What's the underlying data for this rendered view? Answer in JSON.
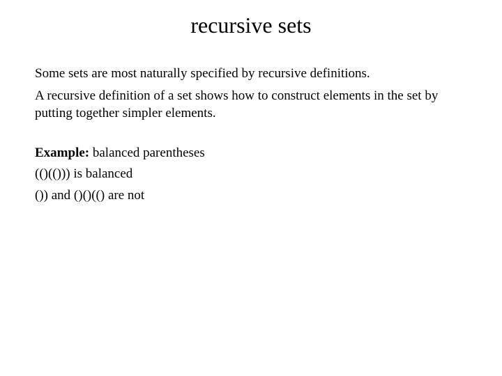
{
  "slide": {
    "title": "recursive sets",
    "para1": "Some sets are most naturally specified by recursive definitions.",
    "para2": "A recursive definition of a set shows how to construct elements in the set by putting together simpler elements.",
    "example": {
      "label": "Example:",
      "heading_rest": "  balanced parentheses",
      "line1": "(()(())) is balanced",
      "line2": "()) and ()()(() are not"
    }
  }
}
